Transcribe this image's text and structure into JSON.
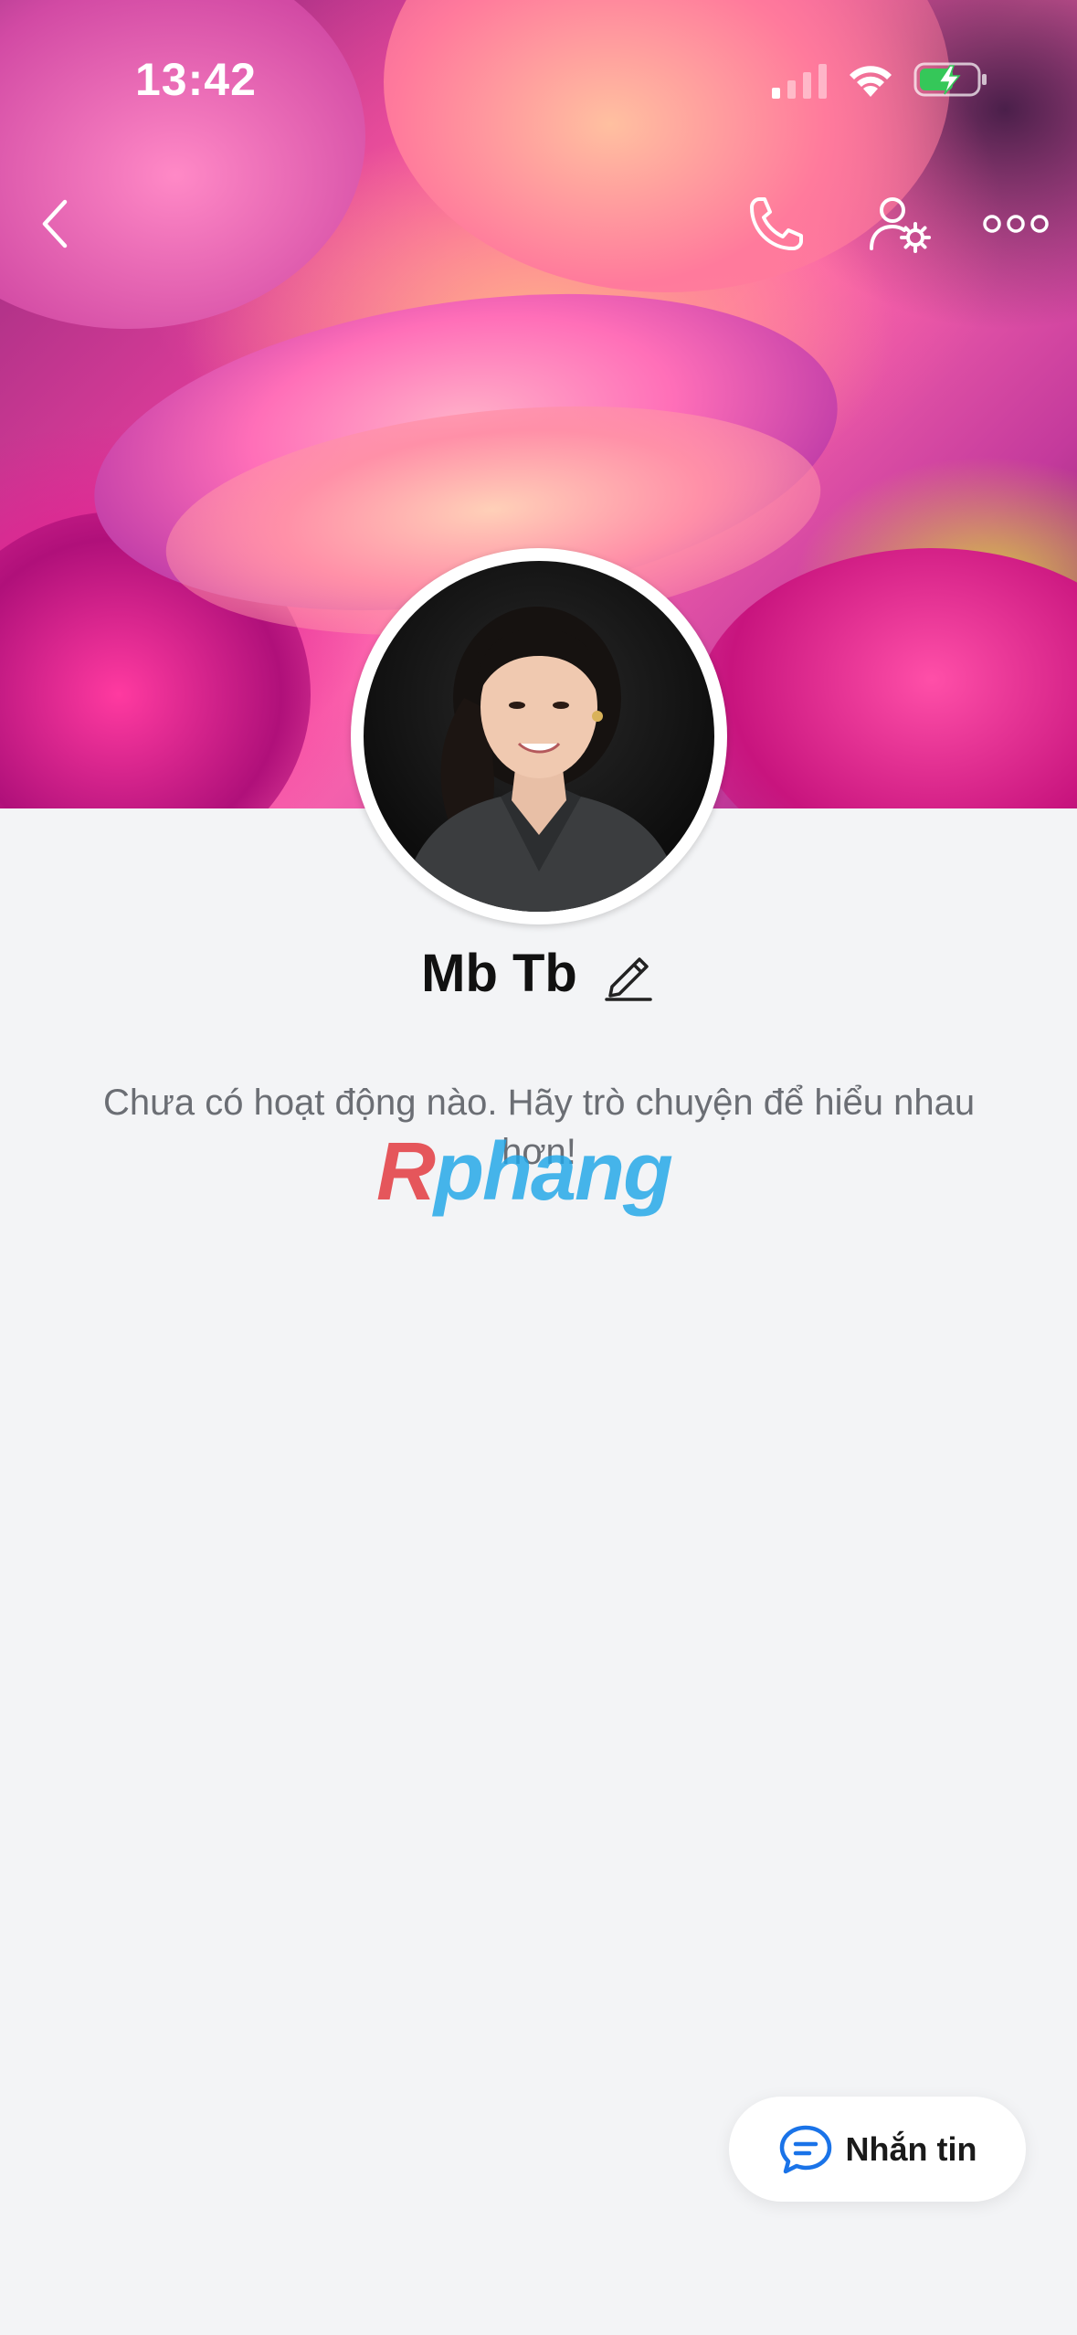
{
  "status_bar": {
    "time": "13:42"
  },
  "nav": {
    "icons": [
      "back-icon",
      "phone-icon",
      "user-settings-icon",
      "more-icon"
    ]
  },
  "profile": {
    "name": "Mb Tb",
    "empty_message": "Chưa có hoạt động nào. Hãy trò chuyện để hiểu nhau hơn!"
  },
  "watermark": {
    "part_a": "R",
    "part_b": "phang"
  },
  "message_button": {
    "label": "Nhắn tin",
    "icon": "chat-bubble-icon"
  },
  "colors": {
    "background": "#f3f4f6",
    "accent": "#1a73e8",
    "battery_green": "#35c759"
  }
}
